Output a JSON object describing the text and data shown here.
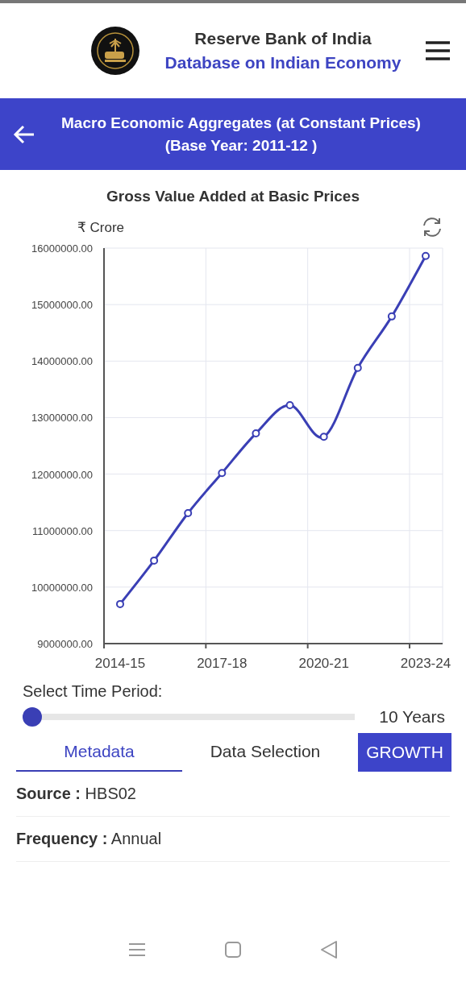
{
  "header": {
    "title": "Reserve Bank of India",
    "subtitle": "Database on Indian Economy"
  },
  "title_bar": {
    "title": "Macro Economic Aggregates (at Constant Prices) (Base Year: 2011-12 )"
  },
  "chart": {
    "chart_data": {
      "type": "line",
      "title": "Gross Value Added at Basic Prices",
      "ylabel": "₹ Crore",
      "grid": true,
      "categories": [
        "2014-15",
        null,
        null,
        "2017-18",
        null,
        null,
        "2020-21",
        null,
        null,
        "2023-24"
      ],
      "series": [
        {
          "color": "#3a3fb5",
          "marker": "circle",
          "values": [
            9700000,
            10470000,
            11310000,
            12020000,
            12720000,
            13220000,
            12660000,
            13880000,
            14790000,
            15860000
          ]
        }
      ],
      "ylim": [
        9000000,
        16000000
      ],
      "yticks": [
        {
          "value": 9000000,
          "label": "9000000.00"
        },
        {
          "value": 10000000,
          "label": "10000000.00"
        },
        {
          "value": 11000000,
          "label": "11000000.00"
        },
        {
          "value": 12000000,
          "label": "12000000.00"
        },
        {
          "value": 13000000,
          "label": "13000000.00"
        },
        {
          "value": 14000000,
          "label": "14000000.00"
        },
        {
          "value": 15000000,
          "label": "15000000.00"
        },
        {
          "value": 16000000,
          "label": "16000000.00"
        }
      ]
    }
  },
  "time_period": {
    "label": "Select Time Period:",
    "level": 0,
    "reading": "10 Years"
  },
  "tabs": [
    {
      "label": "Metadata",
      "selected": true
    },
    {
      "label": "Data Selection",
      "selected": false
    }
  ],
  "growth_button": "GROWTH",
  "metadata": [
    {
      "label": "Source :",
      "value": "HBS02"
    },
    {
      "label": "Frequency :",
      "value": "Annual"
    }
  ]
}
